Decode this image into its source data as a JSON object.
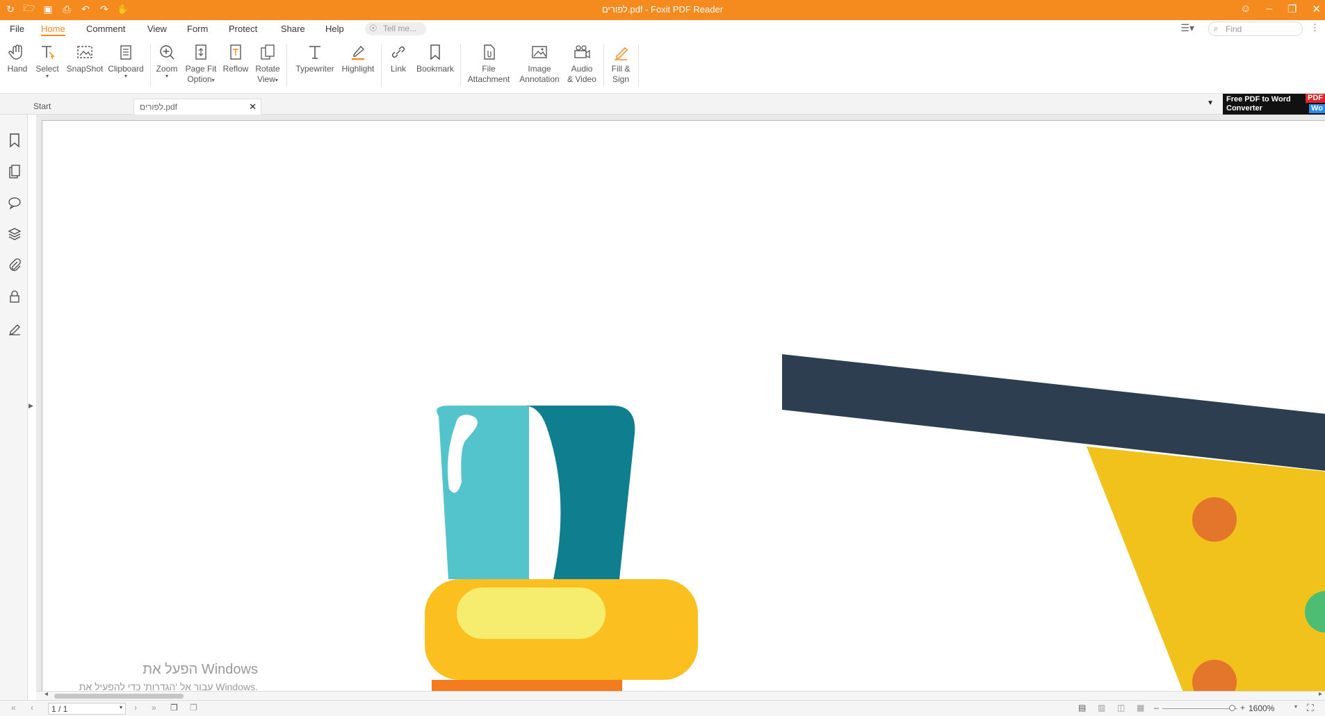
{
  "app": {
    "window_title": "לפורים.pdf - Foxit PDF Reader",
    "accent_color": "#f58a1f"
  },
  "quick_access": [
    {
      "name": "foxit-logo-icon"
    },
    {
      "name": "open-folder-icon"
    },
    {
      "name": "save-icon"
    },
    {
      "name": "print-icon"
    },
    {
      "name": "undo-icon"
    },
    {
      "name": "redo-icon"
    },
    {
      "name": "hand-tool-icon"
    }
  ],
  "menu": {
    "items": [
      "File",
      "Home",
      "Comment",
      "View",
      "Form",
      "Protect",
      "Share",
      "Help"
    ],
    "active": "Home",
    "tell_me_placeholder": "Tell me...",
    "find_placeholder": "Find"
  },
  "ribbon": {
    "hand": "Hand",
    "select": "Select",
    "snapshot": "SnapShot",
    "clipboard": "Clipboard",
    "zoom": "Zoom",
    "page_fit_1": "Page Fit",
    "page_fit_2": "Option",
    "reflow": "Reflow",
    "rotate_1": "Rotate",
    "rotate_2": "View",
    "typewriter": "Typewriter",
    "highlight": "Highlight",
    "link": "Link",
    "bookmark": "Bookmark",
    "file_att_1": "File",
    "file_att_2": "Attachment",
    "image_ann_1": "Image",
    "image_ann_2": "Annotation",
    "audio_1": "Audio",
    "audio_2": "& Video",
    "fill_1": "Fill &",
    "fill_2": "Sign"
  },
  "tabs": {
    "start": "Start",
    "document": "לפורים.pdf"
  },
  "ad": {
    "line1": "Free PDF to Word",
    "line2": "Converter",
    "badge1": "PDF",
    "badge2": "Wo"
  },
  "watermark": {
    "line1": "הפעל את Windows",
    "line2": "עבור אל 'הגדרות' כדי להפעיל את Windows."
  },
  "status": {
    "page": "1 / 1",
    "zoom": "1600%"
  },
  "colors": {
    "navy_bar": "#2d3e50",
    "yellow": "#f0c21b",
    "orange_dot": "#e3762a",
    "teal_light": "#53c3cc",
    "teal_dark": "#0f7e8e",
    "gold": "#fbbf1f",
    "pale_yellow": "#f6ec6e",
    "orange_base": "#f47c20",
    "green": "#4dbd74"
  }
}
